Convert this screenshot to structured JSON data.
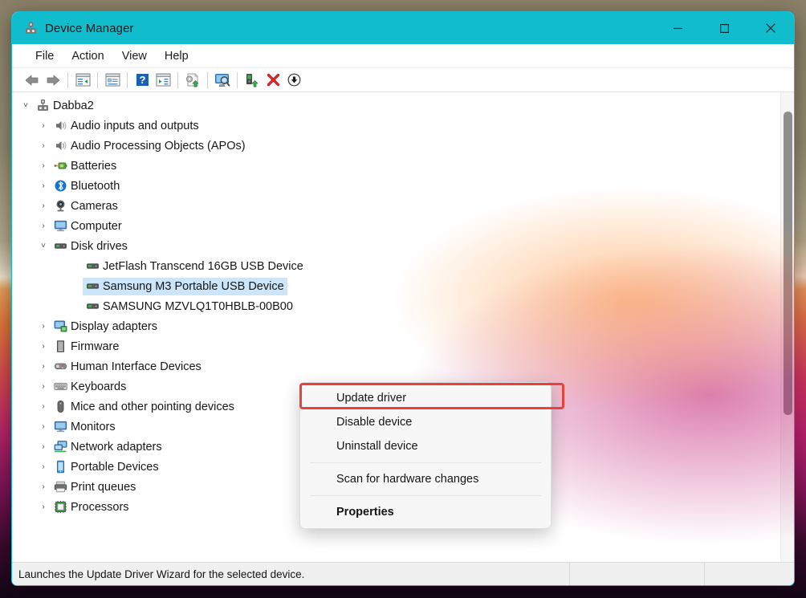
{
  "window": {
    "title": "Device Manager",
    "title_icon": "device-manager-icon",
    "accent_color": "#11bccd",
    "controls": {
      "minimize": "—",
      "maximize": "□",
      "close": "✕"
    }
  },
  "menubar": {
    "items": [
      {
        "label": "File"
      },
      {
        "label": "Action"
      },
      {
        "label": "View"
      },
      {
        "label": "Help"
      }
    ]
  },
  "toolbar": {
    "buttons": [
      {
        "name": "back-icon",
        "tooltip": "Back"
      },
      {
        "name": "forward-icon",
        "tooltip": "Forward"
      },
      {
        "name": "show-hide-console-tree-icon",
        "tooltip": "Show/Hide Console Tree"
      },
      {
        "name": "properties-icon",
        "tooltip": "Properties"
      },
      {
        "name": "help-icon",
        "tooltip": "Help"
      },
      {
        "name": "show-hide-action-pane-icon",
        "tooltip": "Show/Hide Action Pane"
      },
      {
        "name": "update-driver-icon",
        "tooltip": "Update Driver Software"
      },
      {
        "name": "scan-for-hardware-changes-icon",
        "tooltip": "Scan for hardware changes"
      },
      {
        "name": "uninstall-device-icon",
        "tooltip": "Uninstall device"
      },
      {
        "name": "disable-device-icon",
        "tooltip": "Disable device"
      },
      {
        "name": "enable-device-icon",
        "tooltip": "Enable device"
      }
    ]
  },
  "tree": {
    "nodes": [
      {
        "label": "Dabba2",
        "level": 0,
        "expanded": true,
        "chevron": "˅",
        "icon": "computer-node-icon",
        "selected": false
      },
      {
        "label": "Audio inputs and outputs",
        "level": 1,
        "expanded": false,
        "chevron": "›",
        "icon": "speaker-icon",
        "selected": false
      },
      {
        "label": "Audio Processing Objects (APOs)",
        "level": 1,
        "expanded": false,
        "chevron": "›",
        "icon": "speaker-icon",
        "selected": false
      },
      {
        "label": "Batteries",
        "level": 1,
        "expanded": false,
        "chevron": "›",
        "icon": "battery-icon",
        "selected": false
      },
      {
        "label": "Bluetooth",
        "level": 1,
        "expanded": false,
        "chevron": "›",
        "icon": "bluetooth-icon",
        "selected": false
      },
      {
        "label": "Cameras",
        "level": 1,
        "expanded": false,
        "chevron": "›",
        "icon": "camera-icon",
        "selected": false
      },
      {
        "label": "Computer",
        "level": 1,
        "expanded": false,
        "chevron": "›",
        "icon": "monitor-icon",
        "selected": false
      },
      {
        "label": "Disk drives",
        "level": 1,
        "expanded": true,
        "chevron": "˅",
        "icon": "disk-drive-icon",
        "selected": false
      },
      {
        "label": "JetFlash Transcend 16GB USB Device",
        "level": 2,
        "expanded": false,
        "chevron": "",
        "icon": "disk-drive-icon",
        "selected": false
      },
      {
        "label": "Samsung M3 Portable USB Device",
        "level": 2,
        "expanded": false,
        "chevron": "",
        "icon": "disk-drive-icon",
        "selected": true
      },
      {
        "label": "SAMSUNG MZVLQ1T0HBLB-00B00",
        "level": 2,
        "expanded": false,
        "chevron": "",
        "icon": "disk-drive-icon",
        "selected": false
      },
      {
        "label": "Display adapters",
        "level": 1,
        "expanded": false,
        "chevron": "›",
        "icon": "display-adapter-icon",
        "selected": false
      },
      {
        "label": "Firmware",
        "level": 1,
        "expanded": false,
        "chevron": "›",
        "icon": "firmware-icon",
        "selected": false
      },
      {
        "label": "Human Interface Devices",
        "level": 1,
        "expanded": false,
        "chevron": "›",
        "icon": "hid-icon",
        "selected": false
      },
      {
        "label": "Keyboards",
        "level": 1,
        "expanded": false,
        "chevron": "›",
        "icon": "keyboard-icon",
        "selected": false
      },
      {
        "label": "Mice and other pointing devices",
        "level": 1,
        "expanded": false,
        "chevron": "›",
        "icon": "mouse-icon",
        "selected": false
      },
      {
        "label": "Monitors",
        "level": 1,
        "expanded": false,
        "chevron": "›",
        "icon": "monitor-icon",
        "selected": false
      },
      {
        "label": "Network adapters",
        "level": 1,
        "expanded": false,
        "chevron": "›",
        "icon": "network-adapter-icon",
        "selected": false
      },
      {
        "label": "Portable Devices",
        "level": 1,
        "expanded": false,
        "chevron": "›",
        "icon": "portable-device-icon",
        "selected": false
      },
      {
        "label": "Print queues",
        "level": 1,
        "expanded": false,
        "chevron": "›",
        "icon": "printer-icon",
        "selected": false
      },
      {
        "label": "Processors",
        "level": 1,
        "expanded": false,
        "chevron": "›",
        "icon": "processor-icon",
        "selected": false
      }
    ]
  },
  "context_menu": {
    "highlight_color": "#e8403a",
    "items": [
      {
        "label": "Update driver",
        "bold": false,
        "highlighted": true
      },
      {
        "label": "Disable device",
        "bold": false,
        "highlighted": false
      },
      {
        "label": "Uninstall device",
        "bold": false,
        "highlighted": false
      },
      {
        "separator": true
      },
      {
        "label": "Scan for hardware changes",
        "bold": false,
        "highlighted": false
      },
      {
        "separator": true
      },
      {
        "label": "Properties",
        "bold": true,
        "highlighted": false
      }
    ]
  },
  "statusbar": {
    "text": "Launches the Update Driver Wizard for the selected device."
  }
}
